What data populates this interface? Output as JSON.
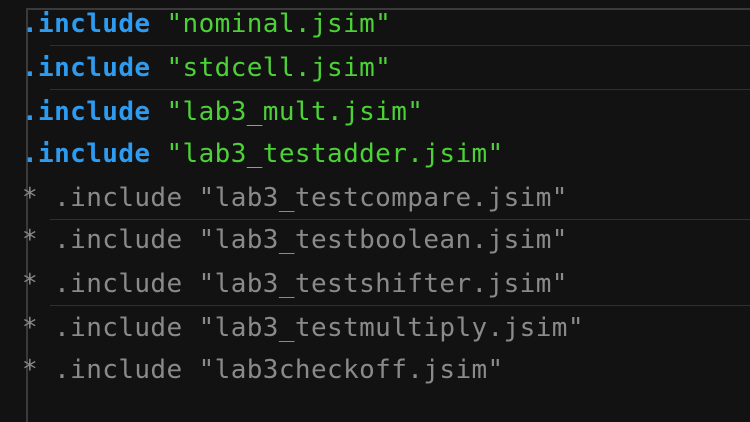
{
  "editor": {
    "lines": [
      {
        "prefix": "",
        "keyword": ".include",
        "text": " \"nominal.jsim\""
      },
      {
        "prefix": "",
        "keyword": ".include",
        "text": " \"stdcell.jsim\""
      },
      {
        "prefix": "",
        "keyword": ".include",
        "text": " \"lab3_mult.jsim\""
      },
      {
        "prefix": "",
        "keyword": ".include",
        "text": " \"lab3_testadder.jsim\""
      },
      {
        "comment": "* .include \"lab3_testcompare.jsim\""
      },
      {
        "comment": "* .include \"lab3_testboolean.jsim\""
      },
      {
        "comment": "* .include \"lab3_testshifter.jsim\""
      },
      {
        "comment": "* .include \"lab3_testmultiply.jsim\""
      },
      {
        "comment": "* .include \"lab3checkoff.jsim\""
      }
    ]
  },
  "colors": {
    "background": "#121212",
    "keyword": "#2d9bf0",
    "string": "#4cd137",
    "comment": "#8a8a8a"
  }
}
